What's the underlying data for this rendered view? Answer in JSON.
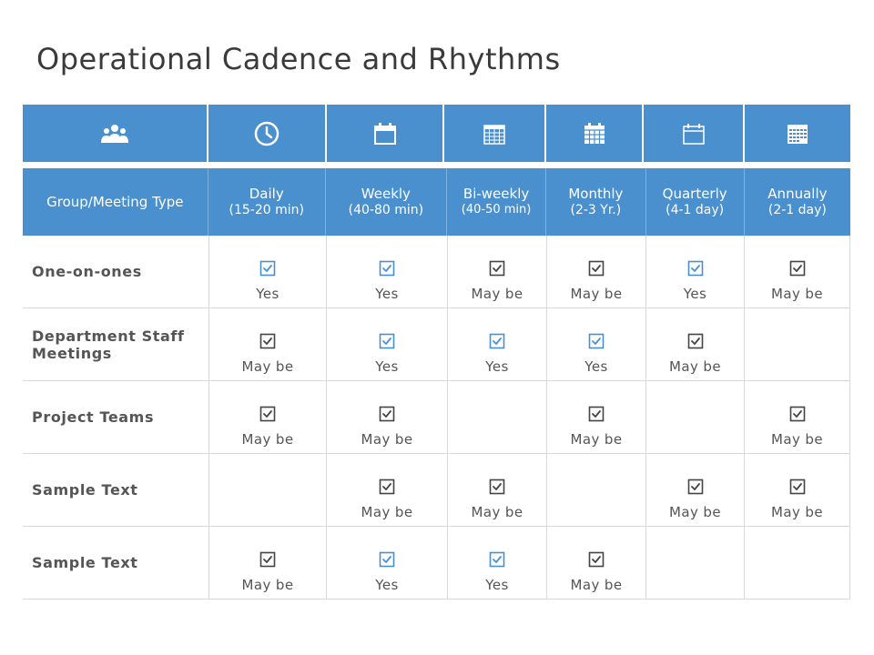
{
  "title": "Operational Cadence and Rhythms",
  "accent_color": "#4a90cf",
  "check_colors": {
    "Yes": "#4a90cf",
    "May be": "#444444"
  },
  "icons": [
    "group-icon",
    "clock-icon",
    "calendar-blank-icon",
    "calendar-grid-icon",
    "calendar-monthly-icon",
    "calendar-blank-icon",
    "calendar-full-icon"
  ],
  "header": {
    "group": "Group/Meeting Type",
    "columns": [
      {
        "name": "Daily",
        "sub": "(15-20 min)"
      },
      {
        "name": "Weekly",
        "sub": "(40-80 min)"
      },
      {
        "name": "Bi-weekly",
        "sub": "(40-50 min)"
      },
      {
        "name": "Monthly",
        "sub": "(2-3 Yr.)"
      },
      {
        "name": "Quarterly",
        "sub": "(4-1 day)"
      },
      {
        "name": "Annually",
        "sub": "(2-1 day)"
      }
    ]
  },
  "rows": [
    {
      "label": "One-on-ones",
      "cells": [
        "Yes",
        "Yes",
        "May be",
        "May be",
        "Yes",
        "May be"
      ]
    },
    {
      "label": "Department Staff Meetings",
      "cells": [
        "May be",
        "Yes",
        "Yes",
        "Yes",
        "May be",
        ""
      ]
    },
    {
      "label": "Project Teams",
      "cells": [
        "May be",
        "May be",
        "",
        "May be",
        "",
        "May be"
      ]
    },
    {
      "label": "Sample Text",
      "cells": [
        "",
        "May be",
        "May be",
        "",
        "May be",
        "May be"
      ]
    },
    {
      "label": "Sample Text",
      "cells": [
        "May be",
        "Yes",
        "Yes",
        "May be",
        "",
        ""
      ]
    }
  ]
}
